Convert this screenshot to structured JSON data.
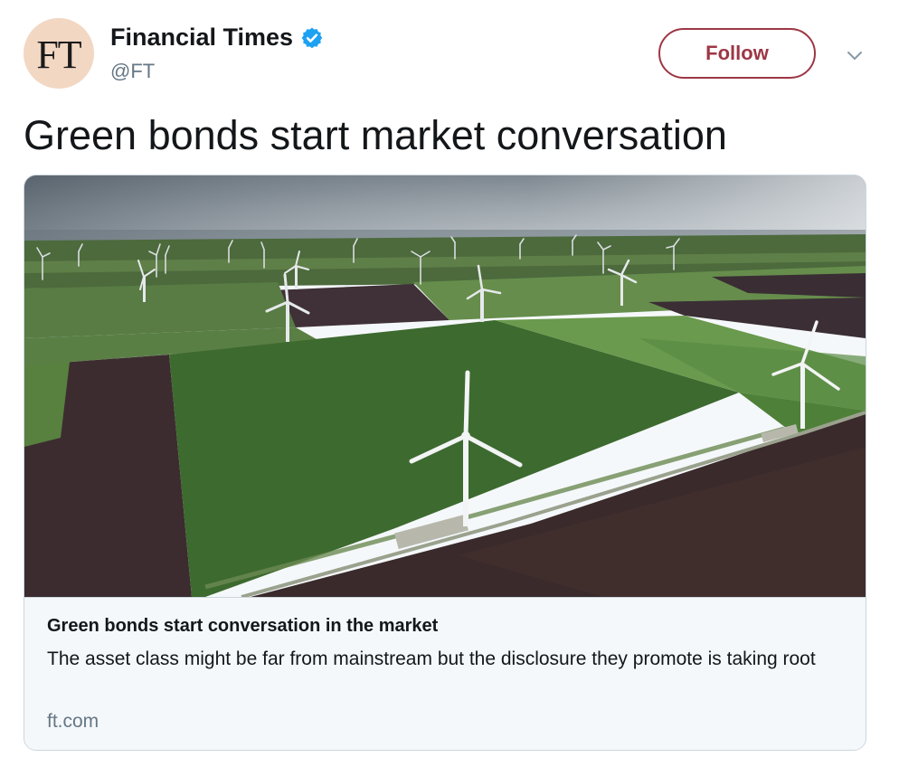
{
  "header": {
    "avatar_text": "FT",
    "display_name": "Financial Times",
    "handle": "@FT",
    "verified": true,
    "follow_label": "Follow"
  },
  "tweet": {
    "text": "Green bonds start market conversation"
  },
  "card": {
    "image_icon": "wind-farm-photo",
    "title": "Green bonds start conversation in the market",
    "description": "The asset class might be far from mainstream but the disclosure they promote is taking root",
    "domain": "ft.com"
  },
  "colors": {
    "avatar_bg": "#f2d7c3",
    "follow_accent": "#9d3745",
    "verified_blue": "#1da1f2",
    "muted_text": "#657786"
  }
}
